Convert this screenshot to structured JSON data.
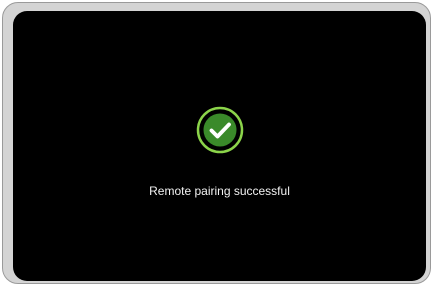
{
  "dialog": {
    "message": "Remote pairing successful",
    "icon": "check-circle-icon"
  },
  "colors": {
    "screen_background": "#000000",
    "frame": "#d4d4d4",
    "frame_border": "#9a9a9a",
    "icon_ring": "#8bd44a",
    "icon_fill": "#3a8a2a",
    "text": "#f2f2f2"
  }
}
